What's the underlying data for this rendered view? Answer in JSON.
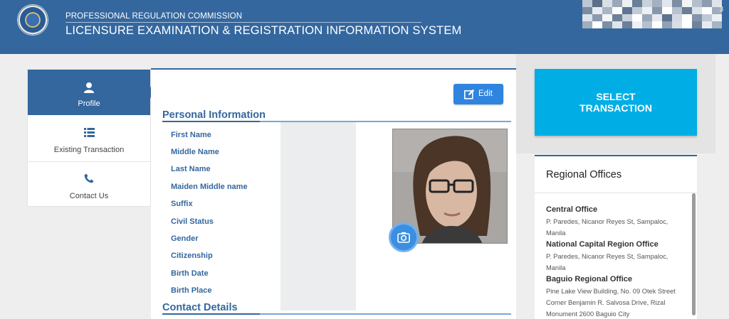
{
  "header": {
    "subtitle": "PROFESSIONAL REGULATION COMMISSION",
    "title": "LICENSURE EXAMINATION & REGISTRATION INFORMATION SYSTEM",
    "user_suffix": "3"
  },
  "nav": {
    "items": [
      {
        "label": "Profile",
        "icon": "user-icon",
        "active": true
      },
      {
        "label": "Existing Transaction",
        "icon": "list-icon",
        "active": false
      },
      {
        "label": "Contact Us",
        "icon": "phone-icon",
        "active": false
      }
    ]
  },
  "profile": {
    "edit_label": "Edit",
    "personal_title": "Personal Information",
    "fields": [
      "First Name",
      "Middle Name",
      "Last Name",
      "Maiden Middle name",
      "Suffix",
      "Civil Status",
      "Gender",
      "Citizenship",
      "Birth Date",
      "Birth Place"
    ],
    "contact_title": "Contact Details"
  },
  "actions": {
    "select_line1": "SELECT",
    "select_line2": "TRANSACTION"
  },
  "regional": {
    "title": "Regional Offices",
    "offices": [
      {
        "name": "Central Office",
        "address": "P. Paredes, Nicanor Reyes St, Sampaloc, Manila"
      },
      {
        "name": "National Capital Region Office",
        "address": "P. Paredes, Nicanor Reyes St, Sampaloc, Manila"
      },
      {
        "name": "Baguio Regional Office",
        "address": "Pine Lake View Building, No. 09 Otek Street Corner Benjamin R. Salvosa Drive, Rizal Monument 2600 Baguio City"
      }
    ]
  },
  "colors": {
    "primary": "#34679e",
    "accent": "#00aee5",
    "edit_button": "#2f84e0"
  }
}
